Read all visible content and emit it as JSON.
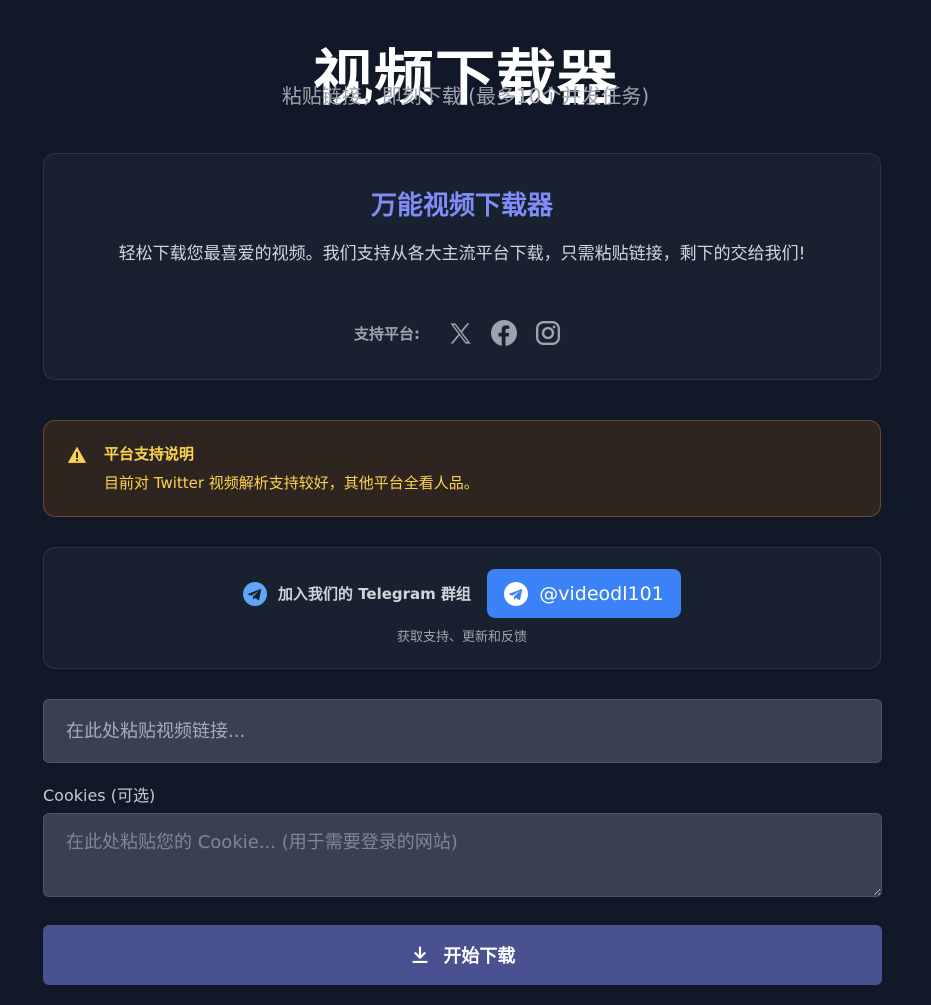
{
  "header": {
    "title": "视频下载器",
    "subtitle": "粘贴链接，即刻下载 (最多10个并发任务)"
  },
  "intro": {
    "title": "万能视频下载器",
    "description": "轻松下载您最喜爱的视频。我们支持从各大主流平台下载，只需粘贴链接，剩下的交给我们!",
    "platforms_label": "支持平台:",
    "platforms": [
      "x-icon",
      "facebook-icon",
      "instagram-icon"
    ]
  },
  "warning": {
    "icon": "warning-icon",
    "title": "平台支持说明",
    "text": "目前对 Twitter 视频解析支持较好，其他平台全看人品。"
  },
  "telegram": {
    "label": "加入我们的 Telegram 群组",
    "button_label": "@videodl101",
    "note": "获取支持、更新和反馈"
  },
  "form": {
    "url_placeholder": "在此处粘贴视频链接...",
    "url_value": "",
    "cookies_label": "Cookies (可选)",
    "cookies_placeholder": "在此处粘贴您的 Cookie... (用于需要登录的网站)",
    "cookies_value": "",
    "submit_label": "开始下载"
  },
  "colors": {
    "background": "#111827",
    "card": "#18212f",
    "accent": "#818cf8",
    "warning": "#fcd34d",
    "telegram": "#3b82f6",
    "submit": "#4a5191"
  }
}
